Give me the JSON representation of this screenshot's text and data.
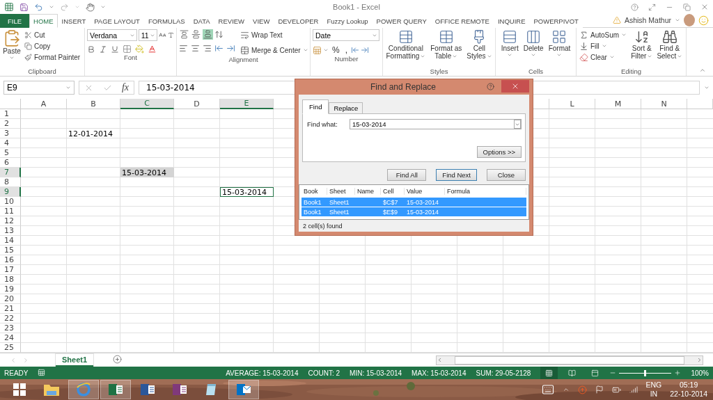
{
  "title_bar": {
    "title": "Book1 - Excel"
  },
  "tabs": [
    {
      "label": "FILE",
      "kind": "file",
      "selected": false
    },
    {
      "label": "HOME",
      "selected": true
    },
    {
      "label": "INSERT",
      "selected": false
    },
    {
      "label": "PAGE LAYOUT",
      "selected": false
    },
    {
      "label": "FORMULAS",
      "selected": false
    },
    {
      "label": "DATA",
      "selected": false
    },
    {
      "label": "REVIEW",
      "selected": false
    },
    {
      "label": "VIEW",
      "selected": false
    },
    {
      "label": "DEVELOPER",
      "selected": false
    },
    {
      "label": "Fuzzy Lookup",
      "selected": false
    },
    {
      "label": "POWER QUERY",
      "selected": false
    },
    {
      "label": "OFFICE REMOTE",
      "selected": false
    },
    {
      "label": "INQUIRE",
      "selected": false
    },
    {
      "label": "POWERPIVOT",
      "selected": false
    }
  ],
  "user": {
    "name": "Ashish Mathur"
  },
  "ribbon": [
    {
      "kind": "clipboard",
      "label": "Clipboard",
      "paste": "Paste",
      "items": [
        "Cut",
        "Copy",
        "Format Painter"
      ]
    },
    {
      "kind": "font",
      "label": "Font",
      "font_name": "Verdana",
      "font_size": "11"
    },
    {
      "kind": "alignment",
      "label": "Alignment",
      "valign_buttons": [
        {
          "selected": false
        },
        {
          "selected": false
        },
        {
          "selected": true
        }
      ],
      "wrap": "Wrap Text",
      "merge": "Merge & Center"
    },
    {
      "kind": "number",
      "label": "Number",
      "format": "Date",
      "symbols": [
        "%",
        ","
      ]
    },
    {
      "kind": "large",
      "label": "Styles",
      "buttons": [
        {
          "lines": [
            "Conditional",
            "Formatting"
          ]
        },
        {
          "lines": [
            "Format as",
            "Table"
          ]
        },
        {
          "lines": [
            "Cell",
            "Styles"
          ]
        }
      ]
    },
    {
      "kind": "large",
      "label": "Cells",
      "buttons": [
        {
          "lines": [
            "Insert"
          ]
        },
        {
          "lines": [
            "Delete"
          ]
        },
        {
          "lines": [
            "Format"
          ]
        }
      ]
    },
    {
      "kind": "editing",
      "label": "Editing",
      "small": [
        "AutoSum",
        "Fill",
        "Clear"
      ],
      "buttons": [
        {
          "lines": [
            "Sort &",
            "Filter"
          ]
        },
        {
          "lines": [
            "Find &",
            "Select"
          ]
        }
      ]
    }
  ],
  "formula_bar": {
    "name_box": "E9",
    "function_label": "fx",
    "formula": "15-03-2014"
  },
  "columns_left": [
    {
      "label": "A",
      "selected": false
    },
    {
      "label": "B",
      "selected": false
    },
    {
      "label": "C",
      "selected": true
    },
    {
      "label": "D",
      "selected": false
    },
    {
      "label": "E",
      "selected": true
    }
  ],
  "columns_right": [
    {
      "label": "L",
      "selected": false
    },
    {
      "label": "M",
      "selected": false
    },
    {
      "label": "N",
      "selected": false
    }
  ],
  "rows": [
    {
      "number": "1",
      "selected": false
    },
    {
      "number": "2",
      "selected": false
    },
    {
      "number": "3",
      "selected": false,
      "cells": {
        "B": {
          "text": "12-01-2014",
          "highlighted": false,
          "active": false
        }
      }
    },
    {
      "number": "4",
      "selected": false
    },
    {
      "number": "5",
      "selected": false
    },
    {
      "number": "6",
      "selected": false
    },
    {
      "number": "7",
      "selected": true,
      "cells": {
        "C": {
          "text": "15-03-2014",
          "highlighted": true,
          "active": false
        }
      }
    },
    {
      "number": "8",
      "selected": false
    },
    {
      "number": "9",
      "selected": true,
      "cells": {
        "E": {
          "text": "15-03-2014",
          "highlighted": false,
          "active": true
        }
      }
    },
    {
      "number": "10",
      "selected": false
    },
    {
      "number": "11",
      "selected": false
    },
    {
      "number": "12",
      "selected": false
    },
    {
      "number": "13",
      "selected": false
    },
    {
      "number": "14",
      "selected": false
    },
    {
      "number": "15",
      "selected": false
    },
    {
      "number": "16",
      "selected": false
    },
    {
      "number": "17",
      "selected": false
    },
    {
      "number": "18",
      "selected": false
    },
    {
      "number": "19",
      "selected": false
    },
    {
      "number": "20",
      "selected": false
    },
    {
      "number": "21",
      "selected": false
    },
    {
      "number": "22",
      "selected": false
    },
    {
      "number": "23",
      "selected": false
    },
    {
      "number": "24",
      "selected": false
    },
    {
      "number": "25",
      "selected": false
    }
  ],
  "find_dialog": {
    "title": "Find and Replace",
    "tabs": [
      {
        "label": "Find",
        "selected": true
      },
      {
        "label": "Replace",
        "selected": false
      }
    ],
    "find_label": "Find what:",
    "find_value": "15-03-2014",
    "options_button": "Options >>",
    "buttons": [
      {
        "label": "Find All",
        "focused": false
      },
      {
        "label": "Find Next",
        "focused": true
      },
      {
        "label": "Close",
        "focused": false
      }
    ],
    "results": {
      "columns": [
        "Book",
        "Sheet",
        "Name",
        "Cell",
        "Value",
        "Formula"
      ],
      "rows": [
        {
          "selected": true,
          "book": "Book1",
          "sheet": "Sheet1",
          "cell": "$C$7",
          "value": "15-03-2014"
        },
        {
          "selected": true,
          "book": "Book1",
          "sheet": "Sheet1",
          "cell": "$E$9",
          "value": "15-03-2014"
        }
      ]
    },
    "status": "2 cell(s) found"
  },
  "sheet_tabs": [
    {
      "label": "Sheet1",
      "selected": true
    }
  ],
  "status_bar": {
    "mode": "READY",
    "stats": [
      "AVERAGE: 15-03-2014",
      "COUNT: 2",
      "MIN: 15-03-2014",
      "MAX: 15-03-2014",
      "SUM: 29-05-2128"
    ],
    "views": [
      {
        "selected": true
      },
      {
        "selected": false
      },
      {
        "selected": false
      }
    ],
    "zoom": {
      "level": 0.5,
      "reading": "100%"
    }
  },
  "taskbar": {
    "apps": [
      {
        "kind": "start",
        "running": false
      },
      {
        "kind": "folder",
        "running": false
      },
      {
        "kind": "browser",
        "running": true
      },
      {
        "kind": "sheet",
        "running": true
      },
      {
        "kind": "doc",
        "running": false
      },
      {
        "kind": "notes",
        "running": false
      },
      {
        "kind": "pad",
        "running": false
      },
      {
        "kind": "mail",
        "running": true
      }
    ],
    "tray": {
      "language": "ENG",
      "region": "IN",
      "time": "05:19",
      "date": "22-10-2014"
    }
  }
}
